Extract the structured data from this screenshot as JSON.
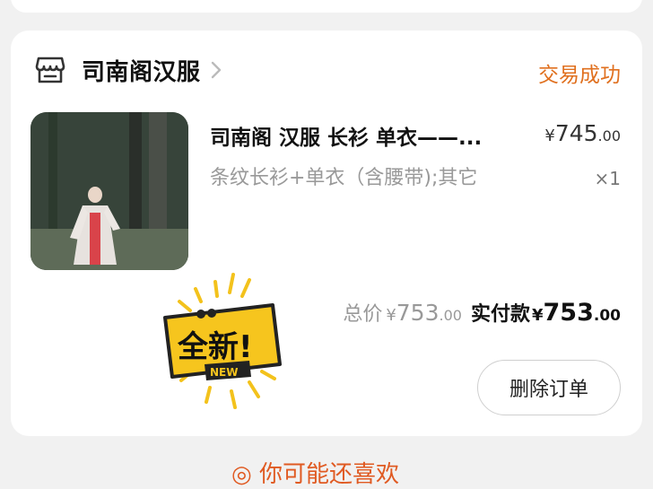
{
  "order": {
    "store_name": "司南阁汉服",
    "status": "交易成功",
    "item": {
      "title": "司南阁 汉服 长衫 单衣——...",
      "variant": "条纹长衫+单衣（含腰带);其它",
      "price_currency": "¥",
      "price_int": "745",
      "price_dec": ".00",
      "quantity": "×1"
    },
    "badge": {
      "main_text": "全新!",
      "sub_text": "NEW"
    },
    "totals": {
      "total_label": "总价",
      "total_currency": "¥",
      "total_int": "753",
      "total_dec": ".00",
      "paid_label": "实付款",
      "paid_currency": "¥",
      "paid_int": "753",
      "paid_dec": ".00"
    },
    "actions": {
      "delete_label": "删除订单"
    }
  },
  "bottom_hint": "◎ 你可能还喜欢",
  "colors": {
    "status": "#e0701f",
    "accent_orange": "#e05a22",
    "badge_yellow": "#f6c51e"
  }
}
